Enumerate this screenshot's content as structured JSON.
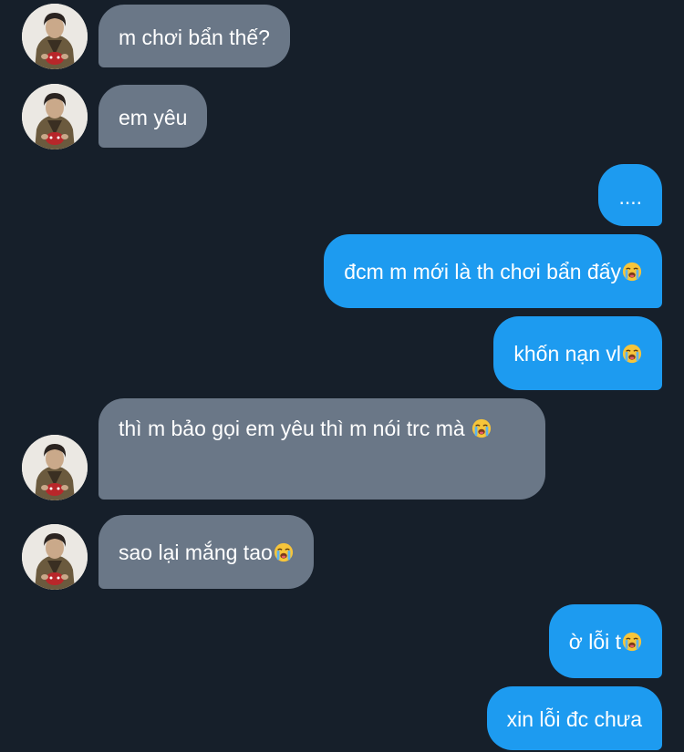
{
  "messages": [
    {
      "side": "incoming",
      "text": "m chơi bẩn thế?",
      "emoji": ""
    },
    {
      "side": "incoming",
      "text": "em yêu",
      "emoji": ""
    },
    {
      "side": "outgoing",
      "text": "....",
      "emoji": ""
    },
    {
      "side": "outgoing",
      "text": "đcm m mới là th chơi bẩn đấy",
      "emoji": "loudly-crying-face-icon"
    },
    {
      "side": "outgoing",
      "text": "khốn nạn vl",
      "emoji": "loudly-crying-face-icon"
    },
    {
      "side": "incoming",
      "text": "thì m bảo gọi em yêu thì m nói trc mà",
      "emoji": "loudly-crying-face-icon"
    },
    {
      "side": "incoming",
      "text": "sao lại mắng tao",
      "emoji": "loudly-crying-face-icon"
    },
    {
      "side": "outgoing",
      "text": "ờ lỗi t",
      "emoji": "loudly-crying-face-icon"
    },
    {
      "side": "outgoing",
      "text": "xin lỗi đc chưa",
      "emoji": ""
    }
  ],
  "colors": {
    "background": "#161f2a",
    "incoming_bubble": "#6a7787",
    "outgoing_bubble": "#1d9bf0",
    "text": "#ffffff"
  }
}
